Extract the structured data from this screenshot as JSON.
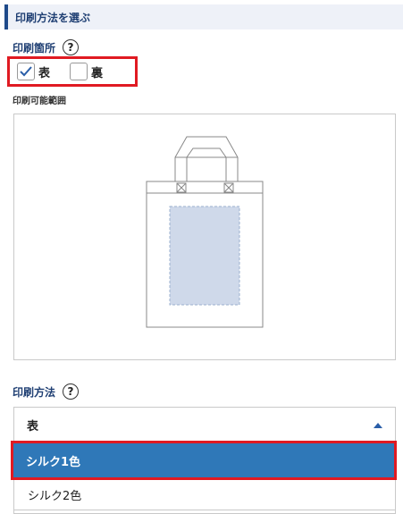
{
  "section": {
    "title": "印刷方法を選ぶ"
  },
  "print_location": {
    "label": "印刷箇所",
    "help": "?",
    "options": [
      {
        "label": "表",
        "checked": true
      },
      {
        "label": "裏",
        "checked": false
      }
    ]
  },
  "print_area": {
    "label": "印刷可能範囲"
  },
  "print_method": {
    "label": "印刷方法",
    "help": "?",
    "selected_side": "表",
    "options": [
      {
        "label": "シルク1色",
        "selected": true
      },
      {
        "label": "シルク2色",
        "selected": false
      }
    ]
  },
  "colors": {
    "accent": "#1f3f73",
    "highlight_red": "#e01a22",
    "selected_blue": "#2f78b8",
    "print_area_fill": "#cfd9ea"
  }
}
